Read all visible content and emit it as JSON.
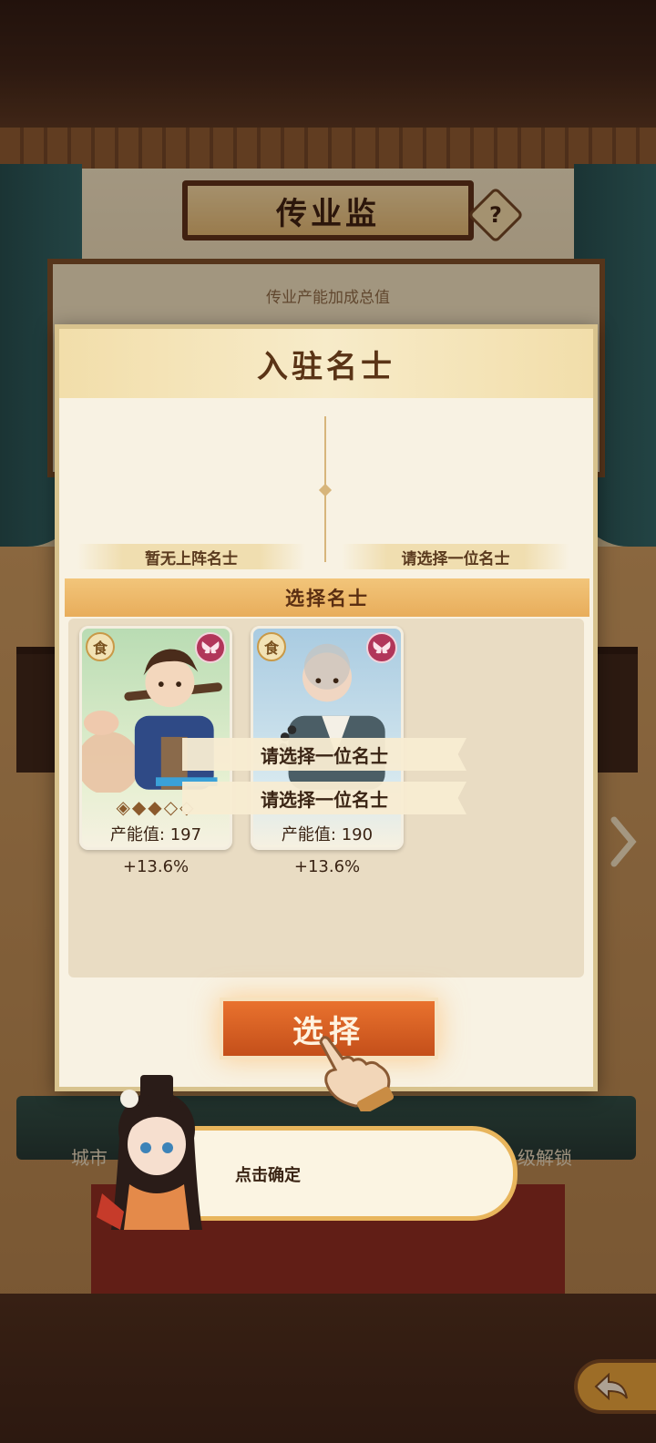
{
  "screen": {
    "title": "传业监",
    "help_label": "?",
    "bonus_total_label": "传业产能加成总值",
    "bottom_left_text": "城市",
    "bottom_right_text": "级解锁"
  },
  "modal": {
    "title": "入驻名士",
    "slot_left_label": "暂无上阵名士",
    "slot_right_label": "请选择一位名士",
    "section_title": "选择名士",
    "select_button": "选择"
  },
  "cards": [
    {
      "type_badge": "食",
      "theme": "green",
      "stars": "◈◆◆◇◇",
      "output": "产能值: 197",
      "bonus": "+13.6%"
    },
    {
      "type_badge": "食",
      "theme": "blue",
      "output": "产能值: 190",
      "bonus": "+13.6%"
    }
  ],
  "tooltips": [
    "请选择一位名士",
    "请选择一位名士"
  ],
  "guide": {
    "text": "点击确定"
  },
  "colors": {
    "accent_orange": "#d95f22",
    "gold": "#e8b55c",
    "brown_text": "#3a2414"
  }
}
